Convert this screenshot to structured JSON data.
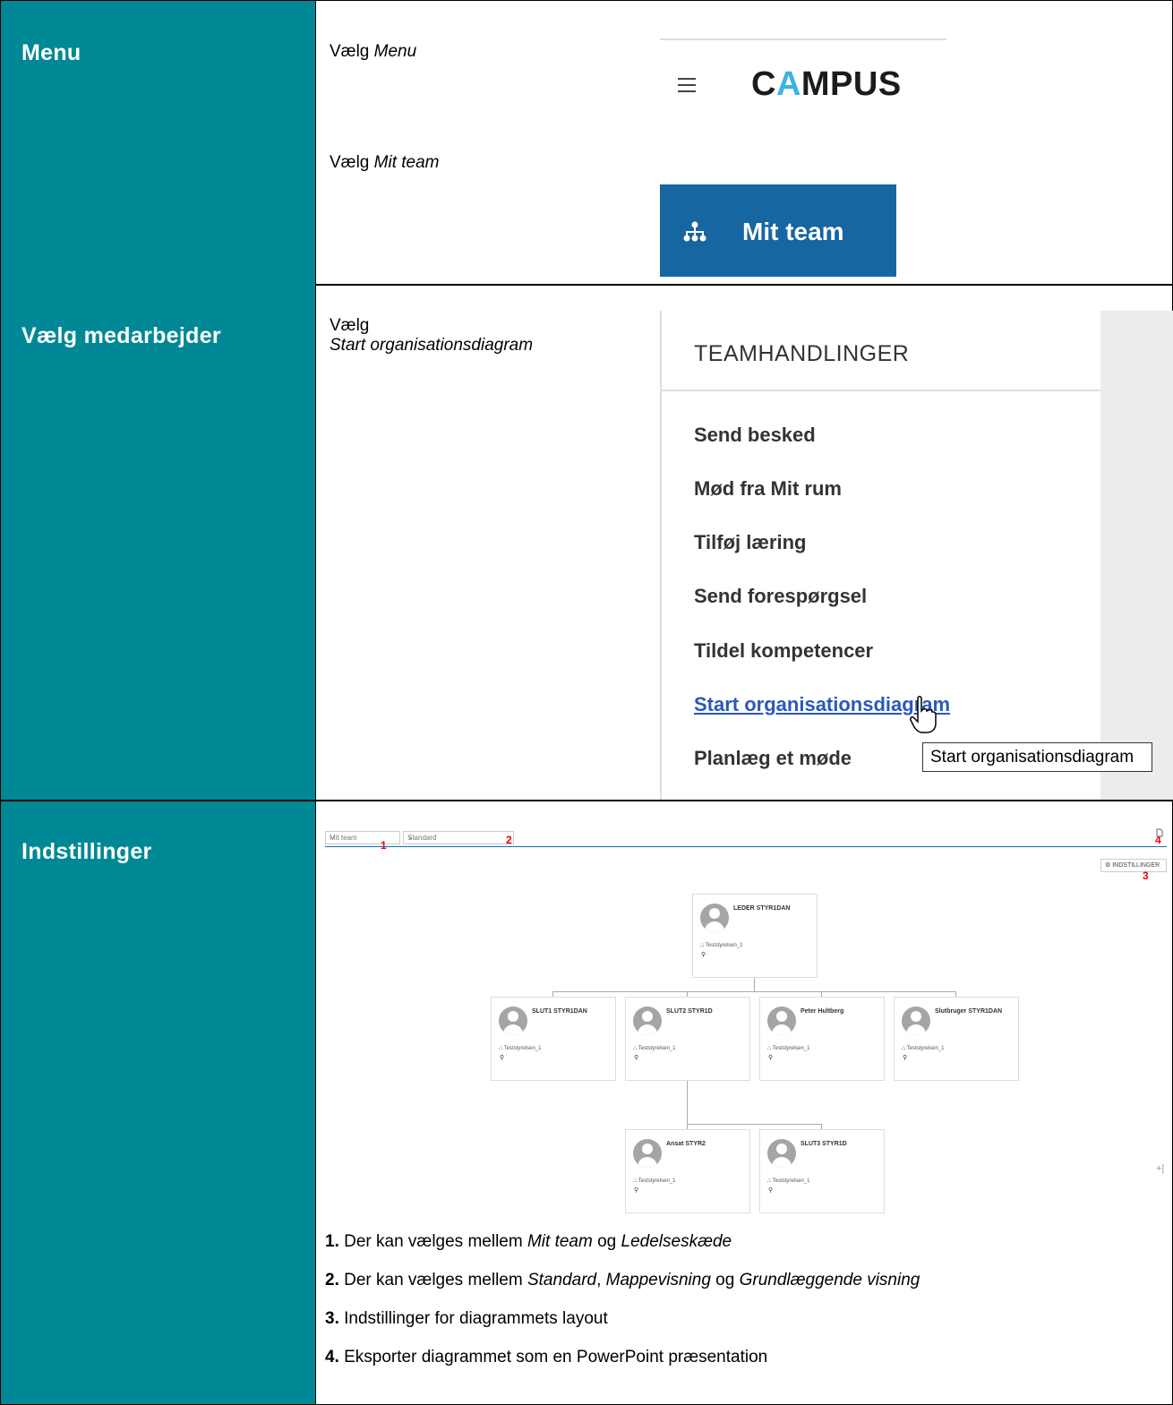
{
  "rows": {
    "menu": {
      "heading": "Menu",
      "step1_prefix": "Vælg",
      "step1_item": "Menu",
      "step2_prefix": "Vælg",
      "step2_item": "Mit team",
      "logo_part1": "C",
      "logo_accent": "A",
      "logo_part2": "MPUS",
      "mit_team_button": "Mit team"
    },
    "employee": {
      "heading": "Vælg medarbejder",
      "step_prefix": "Vælg",
      "step_item": "Start organisationsdiagram",
      "panel_title": "TEAMHANDLINGER",
      "actions": [
        "Send besked",
        "Mød fra Mit rum",
        "Tilføj læring",
        "Send forespørgsel",
        "Tildel kompetencer",
        "Start organisationsdiagram",
        "Planlæg et møde"
      ],
      "tooltip": "Start organisationsdiagram"
    },
    "settings": {
      "heading": "Indstillinger",
      "select_team": "Mit team",
      "select_view": "Standard",
      "settings_button": "⚙ INDSTILLINGER",
      "markers": [
        "1",
        "2",
        "3",
        "4"
      ],
      "cards": [
        {
          "name": "LEDER STYR1DAN",
          "dept": "Teststyrelsen_1"
        },
        {
          "name": "SLUT1 STYR1DAN",
          "dept": "Teststyrelsen_1"
        },
        {
          "name": "SLUT2 STYR1D",
          "dept": "Teststyrelsen_1"
        },
        {
          "name": "Peter Hultberg",
          "dept": "Teststyrelsen_1"
        },
        {
          "name": "Slutbruger STYR1DAN",
          "dept": "Teststyrelsen_1"
        },
        {
          "name": "Ansat STYR2",
          "dept": "Teststyrelsen_1"
        },
        {
          "name": "SLUT3 STYR1D",
          "dept": "Teststyrelsen_1"
        }
      ],
      "notes": [
        {
          "num": "1.",
          "parts": [
            [
              "Der kan vælges mellem ",
              ""
            ],
            [
              "Mit team",
              "i"
            ],
            [
              " og ",
              ""
            ],
            [
              "Ledelseskæde",
              "i"
            ]
          ]
        },
        {
          "num": "2.",
          "parts": [
            [
              "Der kan vælges mellem ",
              ""
            ],
            [
              "Standard",
              "i"
            ],
            [
              ", ",
              ""
            ],
            [
              "Mappevisning",
              "i"
            ],
            [
              " og ",
              ""
            ],
            [
              "Grundlæggende visning",
              "i"
            ]
          ]
        },
        {
          "num": "3.",
          "parts": [
            [
              "Indstillinger for diagrammets layout",
              ""
            ]
          ]
        },
        {
          "num": "4.",
          "parts": [
            [
              "Eksporter diagrammet som en PowerPoint præsentation",
              ""
            ]
          ]
        }
      ]
    }
  },
  "colors": {
    "teal": "#008896",
    "blue_button": "#1566a1",
    "logo_accent": "#3bb3e5",
    "link": "#2a59b8",
    "marker": "#e00000"
  }
}
